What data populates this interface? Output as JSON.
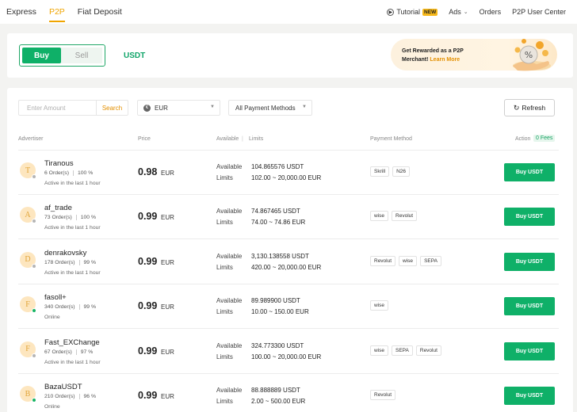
{
  "nav": {
    "items": [
      "Express",
      "P2P",
      "Fiat Deposit"
    ],
    "active": "P2P",
    "tutorial": "Tutorial",
    "new_badge": "NEW",
    "ads": "Ads",
    "orders": "Orders",
    "user_center": "P2P User Center"
  },
  "trade": {
    "buy_label": "Buy",
    "sell_label": "Sell",
    "coin": "USDT"
  },
  "promo": {
    "line1": "Get Rewarded as a P2P",
    "line2": "Merchant!",
    "learn_more": "Learn More"
  },
  "filters": {
    "amount_placeholder": "Enter Amount",
    "search_label": "Search",
    "currency": "EUR",
    "currency_symbol": "€",
    "payment_methods": "All Payment Methods",
    "refresh_label": "Refresh"
  },
  "table": {
    "headers": {
      "advertiser": "Advertiser",
      "price": "Price",
      "available": "Available",
      "limits": "Limits",
      "payment": "Payment Method",
      "action": "Action",
      "fees": "0 Fees"
    },
    "available_label": "Available",
    "limits_label": "Limits",
    "rows": [
      {
        "initial": "T",
        "name": "Tiranous",
        "orders": "6 Order(s)",
        "completion": "100 %",
        "activity": "Active in the last 1 hour",
        "status_color": "#b5b5b5",
        "price": "0.98",
        "currency": "EUR",
        "available": "104.865576 USDT",
        "limits": "102.00 ~ 20,000.00 EUR",
        "payments": [
          "Skrill",
          "N26"
        ],
        "button": "Buy USDT"
      },
      {
        "initial": "A",
        "name": "af_trade",
        "orders": "73 Order(s)",
        "completion": "100 %",
        "activity": "Active in the last 1 hour",
        "status_color": "#b5b5b5",
        "price": "0.99",
        "currency": "EUR",
        "available": "74.867465 USDT",
        "limits": "74.00 ~ 74.86 EUR",
        "payments": [
          "wise",
          "Revolut"
        ],
        "button": "Buy USDT"
      },
      {
        "initial": "D",
        "name": "denrakovsky",
        "orders": "178 Order(s)",
        "completion": "99 %",
        "activity": "Active in the last 1 hour",
        "status_color": "#b5b5b5",
        "price": "0.99",
        "currency": "EUR",
        "available": "3,130.138558 USDT",
        "limits": "420.00 ~ 20,000.00 EUR",
        "payments": [
          "Revolut",
          "wise",
          "SEPA"
        ],
        "button": "Buy USDT"
      },
      {
        "initial": "F",
        "name": "fasoll+",
        "orders": "340 Order(s)",
        "completion": "99 %",
        "activity": "Online",
        "status_color": "#16b364",
        "price": "0.99",
        "currency": "EUR",
        "available": "89.989900 USDT",
        "limits": "10.00 ~ 150.00 EUR",
        "payments": [
          "wise"
        ],
        "button": "Buy USDT"
      },
      {
        "initial": "F",
        "name": "Fast_EXChange",
        "orders": "67 Order(s)",
        "completion": "97 %",
        "activity": "Active in the last 1 hour",
        "status_color": "#b5b5b5",
        "price": "0.99",
        "currency": "EUR",
        "available": "324.773300 USDT",
        "limits": "100.00 ~ 20,000.00 EUR",
        "payments": [
          "wise",
          "SEPA",
          "Revolut"
        ],
        "button": "Buy USDT"
      },
      {
        "initial": "B",
        "name": "BazaUSDT",
        "orders": "210 Order(s)",
        "completion": "96 %",
        "activity": "Online",
        "status_color": "#16b364",
        "price": "0.99",
        "currency": "EUR",
        "available": "88.888889 USDT",
        "limits": "2.00 ~ 500.00 EUR",
        "payments": [
          "Revolut"
        ],
        "button": "Buy USDT"
      }
    ]
  }
}
